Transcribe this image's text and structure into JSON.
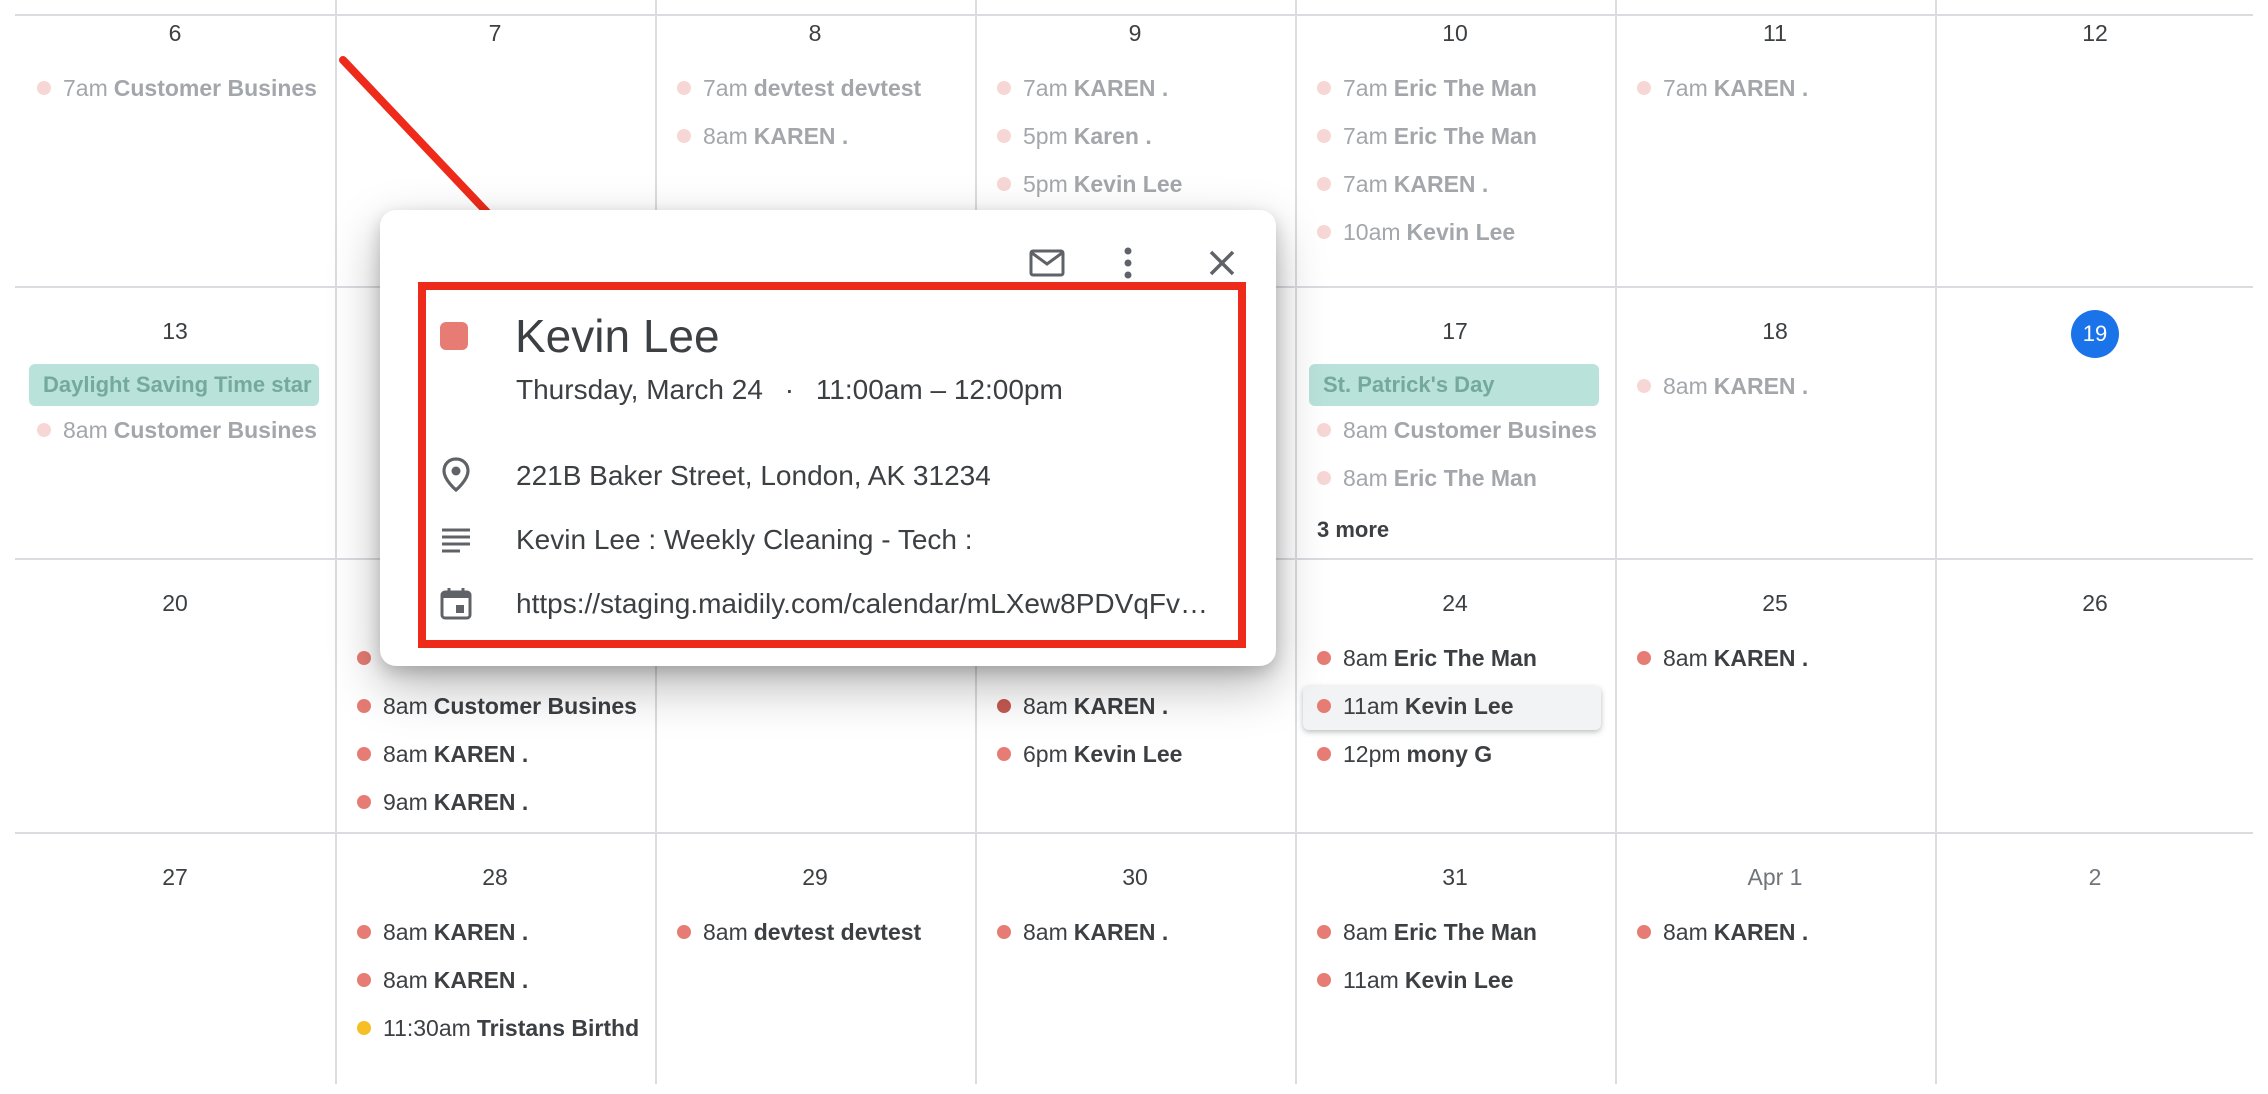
{
  "calendar": {
    "weeks": [
      {
        "days": [
          {
            "label": "6",
            "events": [
              {
                "time": "7am",
                "title": "Customer Busines",
                "color": "#e67c73",
                "faded": true
              }
            ]
          },
          {
            "label": "7",
            "events": []
          },
          {
            "label": "8",
            "events": [
              {
                "time": "7am",
                "title": "devtest devtest",
                "color": "#e67c73",
                "faded": true
              },
              {
                "time": "8am",
                "title": "KAREN .",
                "color": "#e67c73",
                "faded": true
              }
            ]
          },
          {
            "label": "9",
            "events": [
              {
                "time": "7am",
                "title": "KAREN .",
                "color": "#e67c73",
                "faded": true
              },
              {
                "time": "5pm",
                "title": "Karen .",
                "color": "#e67c73",
                "faded": true
              },
              {
                "time": "5pm",
                "title": "Kevin Lee",
                "color": "#e67c73",
                "faded": true
              }
            ]
          },
          {
            "label": "10",
            "events": [
              {
                "time": "7am",
                "title": "Eric The Man",
                "color": "#e67c73",
                "faded": true
              },
              {
                "time": "7am",
                "title": "Eric The Man",
                "color": "#e67c73",
                "faded": true
              },
              {
                "time": "7am",
                "title": "KAREN .",
                "color": "#e67c73",
                "faded": true
              },
              {
                "time": "10am",
                "title": "Kevin Lee",
                "color": "#e67c73",
                "faded": true
              }
            ]
          },
          {
            "label": "11",
            "events": [
              {
                "time": "7am",
                "title": "KAREN .",
                "color": "#e67c73",
                "faded": true
              }
            ]
          },
          {
            "label": "12",
            "events": []
          }
        ]
      },
      {
        "days": [
          {
            "label": "13",
            "events": [
              {
                "allday": true,
                "title": "Daylight Saving Time star",
                "faded": true
              },
              {
                "time": "8am",
                "title": "Customer Busines",
                "color": "#e67c73",
                "faded": true
              }
            ]
          },
          {
            "label": "",
            "events": []
          },
          {
            "label": "",
            "events": []
          },
          {
            "label": "",
            "events": []
          },
          {
            "label": "17",
            "events": [
              {
                "allday": true,
                "title": "St. Patrick's Day",
                "faded": true
              },
              {
                "time": "8am",
                "title": "Customer Busines",
                "color": "#e67c73",
                "faded": true
              },
              {
                "time": "8am",
                "title": "Eric The Man",
                "color": "#e67c73",
                "faded": true
              }
            ],
            "more": "3 more"
          },
          {
            "label": "18",
            "events": [
              {
                "time": "8am",
                "title": "KAREN .",
                "color": "#e67c73",
                "faded": true
              }
            ]
          },
          {
            "label": "19",
            "today": true,
            "events": []
          }
        ]
      },
      {
        "days": [
          {
            "label": "20",
            "events": []
          },
          {
            "label": "",
            "events": [
              {
                "time": "",
                "title": "",
                "color": "#e67c73"
              },
              {
                "time": "8am",
                "title": "Customer Busines",
                "color": "#e67c73"
              },
              {
                "time": "8am",
                "title": "KAREN .",
                "color": "#e67c73"
              },
              {
                "time": "9am",
                "title": "KAREN .",
                "color": "#e67c73"
              }
            ]
          },
          {
            "label": "",
            "events": []
          },
          {
            "label": "",
            "events": [
              {
                "time": "",
                "title": "",
                "color": "#e67c73"
              },
              {
                "time": "8am",
                "title": "KAREN .",
                "color": "#c45a52"
              },
              {
                "time": "6pm",
                "title": "Kevin Lee",
                "color": "#e67c73"
              }
            ]
          },
          {
            "label": "24",
            "events": [
              {
                "time": "8am",
                "title": "Eric The Man",
                "color": "#e67c73"
              },
              {
                "time": "11am",
                "title": "Kevin Lee",
                "color": "#e67c73",
                "raised": true
              },
              {
                "time": "12pm",
                "title": "mony G",
                "color": "#e67c73"
              }
            ]
          },
          {
            "label": "25",
            "events": [
              {
                "time": "8am",
                "title": "KAREN .",
                "color": "#e67c73"
              }
            ]
          },
          {
            "label": "26",
            "events": []
          }
        ]
      },
      {
        "days": [
          {
            "label": "27",
            "events": []
          },
          {
            "label": "28",
            "events": [
              {
                "time": "8am",
                "title": "KAREN .",
                "color": "#e67c73"
              },
              {
                "time": "8am",
                "title": "KAREN .",
                "color": "#e67c73"
              },
              {
                "time": "11:30am",
                "title": "Tristans Birthd",
                "color": "#f6bf26"
              }
            ]
          },
          {
            "label": "29",
            "events": [
              {
                "time": "8am",
                "title": "devtest devtest",
                "color": "#e67c73"
              }
            ]
          },
          {
            "label": "30",
            "events": [
              {
                "time": "8am",
                "title": "KAREN .",
                "color": "#e67c73"
              }
            ]
          },
          {
            "label": "31",
            "events": [
              {
                "time": "8am",
                "title": "Eric The Man",
                "color": "#e67c73"
              },
              {
                "time": "11am",
                "title": "Kevin Lee",
                "color": "#e67c73"
              }
            ]
          },
          {
            "label": "Apr 1",
            "muted": true,
            "events": [
              {
                "time": "8am",
                "title": "KAREN .",
                "color": "#e67c73"
              }
            ]
          },
          {
            "label": "2",
            "muted": true,
            "events": []
          }
        ]
      }
    ]
  },
  "popup": {
    "title": "Kevin Lee",
    "date": "Thursday, March 24",
    "separator": "·",
    "time": "11:00am – 12:00pm",
    "location": "221B Baker Street, London, AK 31234",
    "description": "Kevin Lee : Weekly Cleaning - Tech :",
    "link": "https://staging.maidily.com/calendar/mLXew8PDVqFv…",
    "event_color": "#e67c73",
    "icons": {
      "email": "mail-icon",
      "options": "more-vert-icon",
      "close": "close-icon",
      "location": "location-pin-icon",
      "description": "notes-icon",
      "link": "calendar-icon"
    }
  },
  "annotation": {
    "color": "#ee2b1a"
  }
}
